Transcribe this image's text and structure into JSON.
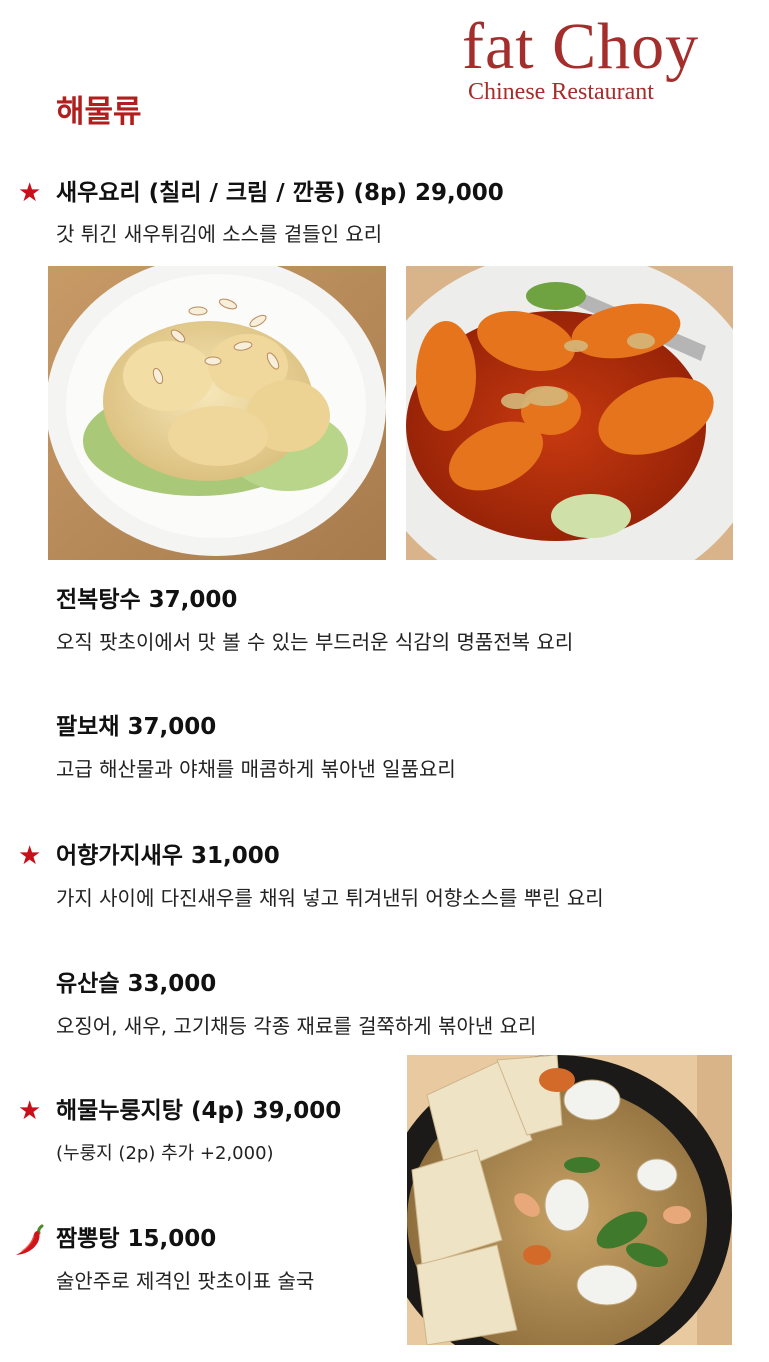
{
  "brand": {
    "name": "fat Choy",
    "subtitle": "Chinese Restaurant"
  },
  "section": {
    "title": "해물류"
  },
  "items": [
    {
      "name": "새우요리 (칠리 / 크림 / 깐풍) (8p) 29,000",
      "desc": "갓 튀긴 새우튀김에 소스를 곁들인 요리",
      "icon": "star-icon"
    },
    {
      "name": "전복탕수 37,000",
      "desc": "오직 팟초이에서 맛 볼 수 있는 부드러운 식감의 명품전복 요리"
    },
    {
      "name": "팔보채 37,000",
      "desc": "고급 해산물과 야채를 매콤하게 볶아낸 일품요리"
    },
    {
      "name": "어향가지새우 31,000",
      "desc": "가지 사이에 다진새우를 채워 넣고 튀겨낸뒤 어향소스를 뿌린 요리",
      "icon": "star-icon"
    },
    {
      "name": "유산슬 33,000",
      "desc": "오징어, 새우, 고기채등 각종 재료를 걸쭉하게 볶아낸 요리"
    },
    {
      "name": "해물누룽지탕 (4p) 39,000",
      "desc": "(누룽지 (2p) 추가 +2,000)",
      "icon": "star-icon"
    },
    {
      "name": "짬뽕탕 15,000",
      "desc": "술안주로 제격인 팟초이표 술국",
      "icon": "chili-icon"
    }
  ],
  "colors": {
    "brand": "#a32e2b",
    "section": "#b01e1e",
    "star": "#c8101a"
  },
  "symbols": {
    "star": "★"
  }
}
